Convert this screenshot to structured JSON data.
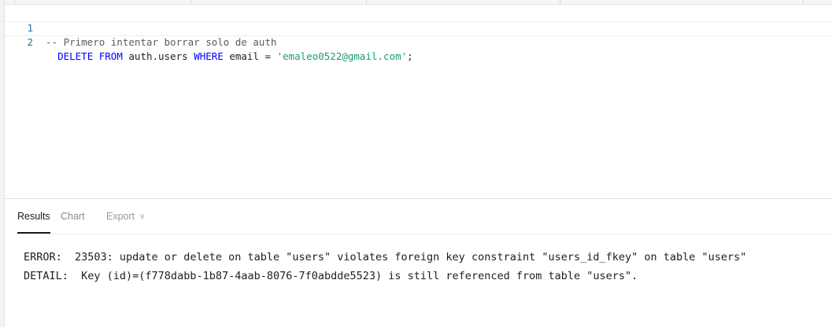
{
  "editor": {
    "lines": [
      {
        "number": "1",
        "comment": "-- Primero intentar borrar solo de auth"
      },
      {
        "number": "2",
        "indent": "  ",
        "kw_delete": "DELETE",
        "kw_from": "FROM",
        "table": "auth.users",
        "kw_where": "WHERE",
        "condition": "email = ",
        "string": "'emaleo0522@gmail.com'",
        "end": ";"
      }
    ]
  },
  "results": {
    "tabs": {
      "results": "Results",
      "chart": "Chart",
      "export": "Export"
    },
    "error_line": "ERROR:  23503: update or delete on table \"users\" violates foreign key constraint \"users_id_fkey\" on table \"users\"",
    "detail_line": "DETAIL:  Key (id)=(f778dabb-1b87-4aab-8076-7f0abdde5523) is still referenced from table \"users\"."
  }
}
